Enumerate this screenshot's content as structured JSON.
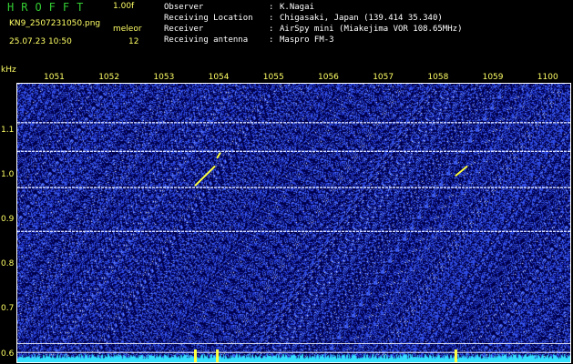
{
  "header": {
    "app_name": "HROFFT",
    "version": "1.00f",
    "file_name": "KN9_2507231050.png",
    "mode_label": "meleor",
    "datetime": "25.07.23 10:50",
    "count_value": "12",
    "info": [
      {
        "key": "Observer",
        "value": "K.Nagai"
      },
      {
        "key": "Receiving Location",
        "value": "Chigasaki, Japan (139.414 35.340)"
      },
      {
        "key": "Receiver",
        "value": "AirSpy mini (Miakejima VOR 108.65MHz)"
      },
      {
        "key": "Receiving antenna",
        "value": "Maspro FM-3"
      }
    ]
  },
  "colors": {
    "app_name": "#33cc33",
    "label_yellow": "#ffff66",
    "info_text": "#ffffff",
    "tick_text": "#ffff66",
    "plot_background": "#00004a",
    "noise_low": "#2a3cff",
    "noise_high": "#ffffff",
    "carrier_line": "#cfd8ff",
    "meteor_trail": "#ffff40",
    "baseline_cyan": "#33e0ff"
  },
  "chart_data": {
    "type": "heatmap",
    "xlabel": "",
    "ylabel": "kHz",
    "x_ticks": [
      "1051",
      "1052",
      "1053",
      "1054",
      "1055",
      "1056",
      "1057",
      "1058",
      "1059",
      "1100"
    ],
    "y_ticks": [
      "1.1",
      "1.0",
      "0.9",
      "0.8",
      "0.7",
      "0.6"
    ],
    "y_tick_values": [
      1.1,
      1.0,
      0.9,
      0.8,
      0.7,
      0.6
    ],
    "ylim": [
      0.583,
      1.205
    ],
    "xlim": [
      10.5,
      1100.8
    ],
    "horizontal_lines_khz": [
      1.118,
      1.054,
      0.973,
      0.875
    ],
    "meteor_echoes": [
      {
        "time_start": 1053.5,
        "time_end": 1053.85,
        "khz_start": 0.978,
        "khz_end": 1.02
      },
      {
        "time_start": 1053.9,
        "time_end": 1053.95,
        "khz_start": 1.04,
        "khz_end": 1.05
      },
      {
        "time_start": 1058.25,
        "time_end": 1058.45,
        "khz_start": 1.0,
        "khz_end": 1.02
      }
    ],
    "grid": false
  }
}
